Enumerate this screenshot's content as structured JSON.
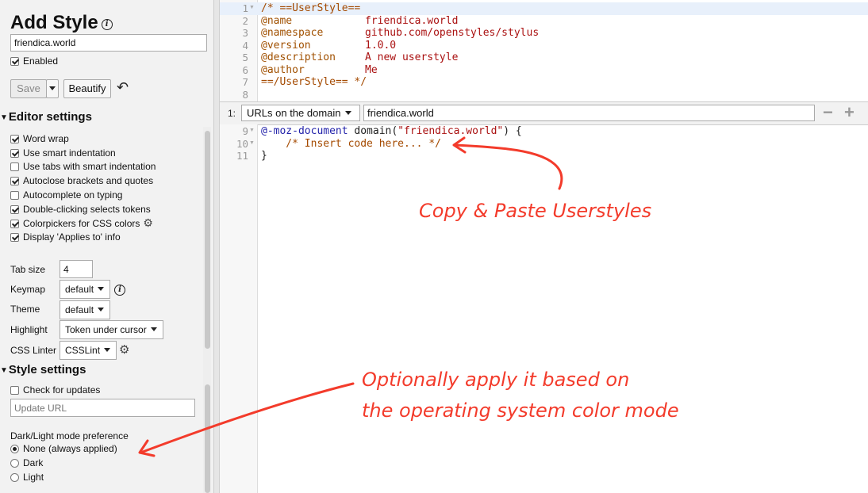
{
  "sidebar": {
    "title": "Add Style",
    "style_name": "friendica.world",
    "enabled_label": "Enabled",
    "enabled": true,
    "save_label": "Save",
    "beautify_label": "Beautify",
    "undo_glyph": "↶",
    "editor_settings": {
      "heading": "Editor settings",
      "options": [
        {
          "label": "Word wrap",
          "checked": true
        },
        {
          "label": "Use smart indentation",
          "checked": true
        },
        {
          "label": "Use tabs with smart indentation",
          "checked": false
        },
        {
          "label": "Autoclose brackets and quotes",
          "checked": true
        },
        {
          "label": "Autocomplete on typing",
          "checked": false
        },
        {
          "label": "Double-clicking selects tokens",
          "checked": true
        },
        {
          "label": "Colorpickers for CSS colors",
          "checked": true
        },
        {
          "label": "Display 'Applies to' info",
          "checked": true
        }
      ],
      "tab_size_label": "Tab size",
      "tab_size_value": "4",
      "keymap_label": "Keymap",
      "keymap_value": "default",
      "theme_label": "Theme",
      "theme_value": "default",
      "highlight_label": "Highlight",
      "highlight_value": "Token under cursor",
      "linter_label": "CSS Linter",
      "linter_value": "CSSLint"
    },
    "style_settings": {
      "heading": "Style settings",
      "check_updates_label": "Check for updates",
      "update_url_placeholder": "Update URL",
      "dark_light_label": "Dark/Light mode preference",
      "modes": [
        {
          "label": "None (always applied)",
          "checked": true
        },
        {
          "label": "Dark",
          "checked": false
        },
        {
          "label": "Light",
          "checked": false
        }
      ]
    }
  },
  "editor": {
    "section1_lines": [
      {
        "n": "1",
        "text": "/* ==UserStyle=="
      },
      {
        "n": "2",
        "key": "@name",
        "val": "friendica.world"
      },
      {
        "n": "3",
        "key": "@namespace",
        "val": "github.com/openstyles/stylus"
      },
      {
        "n": "4",
        "key": "@version",
        "val": "1.0.0"
      },
      {
        "n": "5",
        "key": "@description",
        "val": "A new userstyle"
      },
      {
        "n": "6",
        "key": "@author",
        "val": "Me"
      },
      {
        "n": "7",
        "text": "==/UserStyle== */"
      },
      {
        "n": "8",
        "text": ""
      }
    ],
    "applies_index": "1:",
    "applies_type": "URLs on the domain",
    "applies_value": "friendica.world",
    "section2_lines": [
      {
        "n": "9",
        "kw": "@-moz-document",
        "fn": " domain(",
        "str": "\"friendica.world\"",
        "rest": ") {"
      },
      {
        "n": "10",
        "text": "    /* Insert code here... */"
      },
      {
        "n": "11",
        "text": "}"
      }
    ]
  },
  "annotations": {
    "copy_paste": "Copy & Paste Userstyles",
    "optional_line1": "Optionally apply it based on",
    "optional_line2": "the operating system color mode",
    "color": "#f33b2b"
  }
}
